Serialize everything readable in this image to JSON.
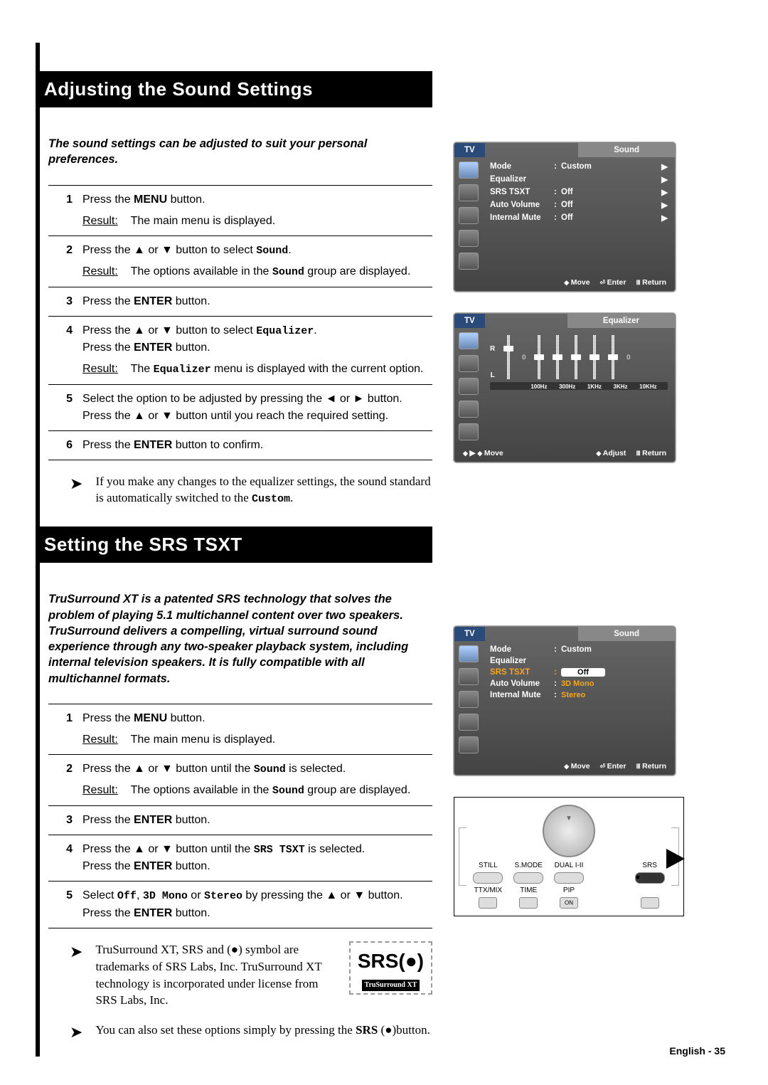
{
  "page": {
    "footer": "English - 35"
  },
  "section1": {
    "title": "Adjusting the Sound Settings",
    "intro": "The sound settings can be adjusted to suit your personal preferences.",
    "steps": {
      "s1_a": "Press the ",
      "s1_menu": "MENU",
      "s1_b": " button.",
      "s1_res_label": "Result:",
      "s1_res": "The main menu is displayed.",
      "s2_a": "Press the ▲ or ▼ button to select ",
      "s2_sound": "Sound",
      "s2_b": ".",
      "s2_res_label": "Result:",
      "s2_res_a": "The options available in the ",
      "s2_res_sound": "Sound",
      "s2_res_b": " group are displayed.",
      "s3_a": "Press the ",
      "s3_enter": "ENTER",
      "s3_b": " button.",
      "s4_a": "Press the ▲ or ▼ button to select ",
      "s4_eq": "Equalizer",
      "s4_b": ".",
      "s4_c": "Press the ",
      "s4_enter": "ENTER",
      "s4_d": " button.",
      "s4_res_label": "Result:",
      "s4_res_a": "The ",
      "s4_res_eq": "Equalizer",
      "s4_res_b": " menu is displayed with the current option.",
      "s5_a": "Select the option to be adjusted by pressing the ◄ or ► button. Press the ▲ or ▼ button until you reach the required setting.",
      "s6_a": "Press the ",
      "s6_enter": "ENTER",
      "s6_b": " button to confirm."
    },
    "note_a": "If you make any changes to the equalizer settings, the sound standard is automatically switched to the ",
    "note_custom": "Custom",
    "note_b": "."
  },
  "section2": {
    "title": "Setting the SRS TSXT",
    "intro": "TruSurround XT is a patented SRS technology that solves the problem of playing 5.1 multichannel content over two speakers. TruSurround delivers a compelling, virtual surround sound experience through any two-speaker playback system, including internal television speakers. It is fully compatible with all multichannel formats.",
    "steps": {
      "s1_a": "Press the ",
      "s1_menu": "MENU",
      "s1_b": " button.",
      "s1_res_label": "Result:",
      "s1_res": "The main menu is displayed.",
      "s2_a": "Press the ▲ or ▼ button until the ",
      "s2_sound": "Sound",
      "s2_b": " is selected.",
      "s2_res_label": "Result:",
      "s2_res_a": "The options available in the ",
      "s2_res_sound": "Sound",
      "s2_res_b": " group are displayed.",
      "s3_a": "Press the ",
      "s3_enter": "ENTER",
      "s3_b": " button.",
      "s4_a": "Press the ▲ or ▼ button until the ",
      "s4_srs": "SRS TSXT",
      "s4_b": " is selected.",
      "s4_c": "Press the ",
      "s4_enter": "ENTER",
      "s4_d": " button.",
      "s5_a": "Select ",
      "s5_off": "Off",
      "s5_mid": ", ",
      "s5_3d": "3D Mono",
      "s5_or": " or ",
      "s5_stereo": "Stereo",
      "s5_b": "  by pressing the ▲ or ▼ button.",
      "s5_c": "Press the ",
      "s5_enter": "ENTER",
      "s5_d": " button."
    },
    "note1_a": "TruSurround XT, SRS and (",
    "note1_sym": "●",
    "note1_b": ") symbol are trademarks of SRS Labs, Inc. TruSurround XT technology is incorporated under license from SRS Labs, Inc.",
    "note2_a": "You can also set these options simply by pressing the ",
    "note2_srs": "SRS",
    "note2_b": " (",
    "note2_sym": "●",
    "note2_c": ")button.",
    "logo_main": "SRS(●)",
    "logo_sub": "TruSurround XT"
  },
  "osd1": {
    "tv": "TV",
    "title": "Sound",
    "rows": {
      "mode_k": "Mode",
      "mode_v": "Custom",
      "eq": "Equalizer",
      "srs_k": "SRS TSXT",
      "srs_v": "Off",
      "av_k": "Auto Volume",
      "av_v": "Off",
      "im_k": "Internal Mute",
      "im_v": "Off"
    },
    "foot": {
      "move": "Move",
      "enter": "Enter",
      "return": "Return"
    }
  },
  "osd2": {
    "tv": "TV",
    "title": "Equalizer",
    "r": "R",
    "l": "L",
    "zero": "0",
    "plus": "+",
    "minus": "-",
    "bands": {
      "b1": "100Hz",
      "b2": "300Hz",
      "b3": "1KHz",
      "b4": "3KHz",
      "b5": "10KHz"
    },
    "foot": {
      "move": "Move",
      "adjust": "Adjust",
      "return": "Return"
    }
  },
  "osd3": {
    "tv": "TV",
    "title": "Sound",
    "rows": {
      "mode_k": "Mode",
      "mode_v": "Custom",
      "eq": "Equalizer",
      "srs_k": "SRS TSXT",
      "off": "Off",
      "av_k": "Auto Volume",
      "av_v": "3D Mono",
      "im_k": "Internal Mute",
      "im_v": "Stereo"
    },
    "foot": {
      "move": "Move",
      "enter": "Enter",
      "return": "Return"
    }
  },
  "remote": {
    "still": "STILL",
    "smode": "S.MODE",
    "dual": "DUAL I-II",
    "srs": "SRS",
    "ttx": "TTX/MIX",
    "time": "TIME",
    "pip": "PIP"
  }
}
